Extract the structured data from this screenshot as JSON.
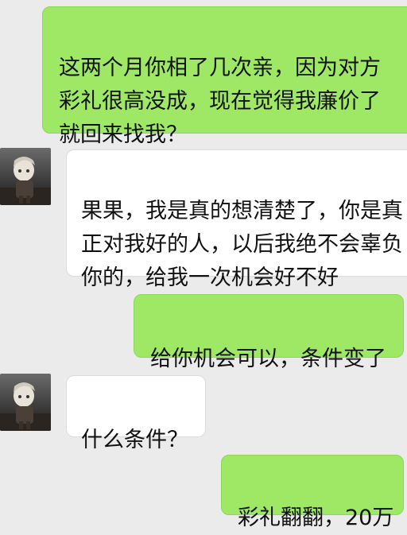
{
  "chat": {
    "messages": [
      {
        "sender": "self",
        "text": "这两个月你相了几次亲，因为对方\n彩礼很高没成，现在觉得我廉价了\n就回来找我？"
      },
      {
        "sender": "other",
        "text": "果果，我是真的想清楚了，你是真\n正对我好的人，以后我绝不会辜负\n你的，给我一次机会好不好"
      },
      {
        "sender": "self",
        "text": "给你机会可以，条件变了"
      },
      {
        "sender": "other",
        "text": "什么条件？"
      },
      {
        "sender": "self",
        "text": "彩礼翻翻，20万"
      }
    ],
    "colors": {
      "background": "#ebebeb",
      "sent_bubble": "#9ee865",
      "received_bubble": "#ffffff"
    }
  }
}
